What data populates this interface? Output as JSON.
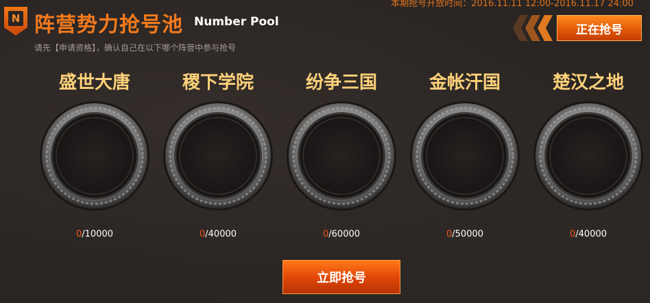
{
  "header": {
    "badge_letter": "N",
    "title": "阵营势力抢号池",
    "subtitle": "Number Pool",
    "hint": "请先【申请资格】，确认自己在以下哪个阵营中参与抢号",
    "period_label": "本期抢号开放时间：",
    "period_value": "2016.11.11 12:00-2016.11.17 24:00",
    "status_label": "正在抢号"
  },
  "factions": [
    {
      "name": "盛世大唐",
      "current": "0",
      "total": "/10000"
    },
    {
      "name": "稷下学院",
      "current": "0",
      "total": "/40000"
    },
    {
      "name": "纷争三国",
      "current": "0",
      "total": "/60000"
    },
    {
      "name": "金帐汗国",
      "current": "0",
      "total": "/50000"
    },
    {
      "name": "楚汉之地",
      "current": "0",
      "total": "/40000"
    }
  ],
  "action": {
    "grab_label": "立即抢号"
  },
  "colors": {
    "accent": "#f47a1c",
    "faction_name": "#ffd27a",
    "count_current": "#f05a1e"
  }
}
